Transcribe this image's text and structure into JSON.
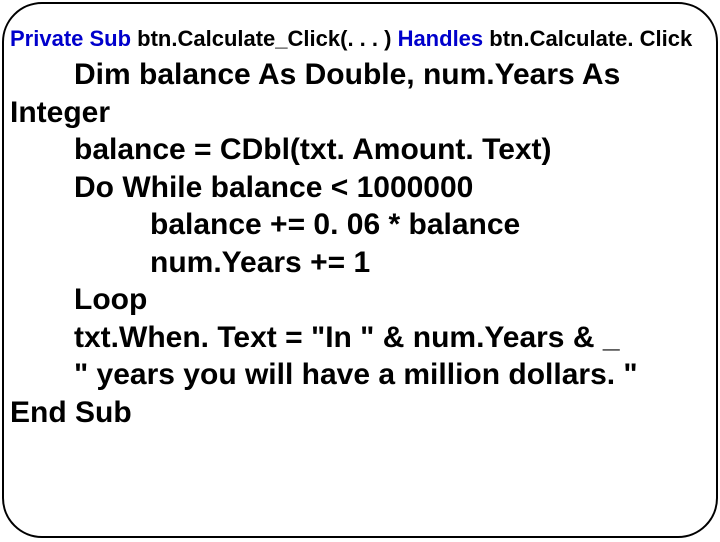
{
  "signature": {
    "kw1": "Private Sub",
    "fname": " btn.Calculate_Click(. . . ) ",
    "kw2": "Handles",
    "handler": " btn.Calculate. Click"
  },
  "lines": {
    "l1a": "Dim balance As Double, num.Years As",
    "l1b": "Integer",
    "l2": "balance = CDbl(txt. Amount. Text)",
    "l3": "Do While balance < 1000000",
    "l4": "balance += 0. 06 * balance",
    "l5": "num.Years += 1",
    "l6": "Loop",
    "l7": "txt.When. Text = \"In \" & num.Years & _",
    "l8": "\" years you will have a million dollars. \"",
    "l9": "End Sub"
  }
}
